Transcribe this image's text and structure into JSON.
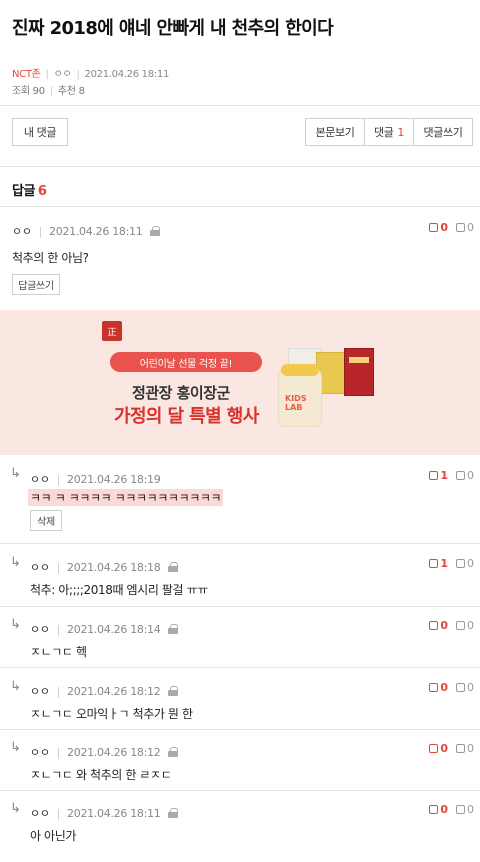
{
  "post": {
    "title": "진짜 2018에 얘네 안빠게 내 천추의 한이다",
    "category": "NCT존",
    "author": "ㅇㅇ",
    "date": "2021.04.26 18:11",
    "views_label": "조회 90",
    "likes_label": "추천 8"
  },
  "buttons": {
    "my_comment": "내 댓글",
    "view_post": "본문보기",
    "comments": "댓글",
    "comments_count": "1",
    "write_comment": "댓글쓰기"
  },
  "replies": {
    "label": "답글",
    "count": "6"
  },
  "comments": [
    {
      "nick": "ㅇㅇ",
      "date": "2021.04.26 18:11",
      "text": "척추의 한 아님?",
      "up": "0",
      "down": "0",
      "action": "답글쓰기"
    },
    {
      "nick": "ㅇㅇ",
      "date": "2021.04.26 18:19",
      "text": "ㅋㅋ ㅋ ㅋㅋㅋㅋ ㅋㅋㅋㅋㅋㅋㅋㅋㅋㅋ",
      "up": "1",
      "down": "0",
      "action": "삭제"
    },
    {
      "nick": "ㅇㅇ",
      "date": "2021.04.26 18:18",
      "text": "척추: 아;;;;2018때 엠시리 팔걸 ㅠㅠ",
      "up": "1",
      "down": "0"
    },
    {
      "nick": "ㅇㅇ",
      "date": "2021.04.26 18:14",
      "text": "ㅈㄴㄱㄷ 헥",
      "up": "0",
      "down": "0"
    },
    {
      "nick": "ㅇㅇ",
      "date": "2021.04.26 18:12",
      "text": "ㅈㄴㄱㄷ 오마익ㅏㄱ 척추가 뭔 한",
      "up": "0",
      "down": "0"
    },
    {
      "nick": "ㅇㅇ",
      "date": "2021.04.26 18:12",
      "text": "ㅈㄴㄱㄷ 와 척추의 한 ㄹㅈㄷ",
      "up": "0",
      "down": "0"
    },
    {
      "nick": "ㅇㅇ",
      "date": "2021.04.26 18:11",
      "text": "아 아닌가",
      "up": "0",
      "down": "0"
    }
  ],
  "ad": {
    "logo": "正",
    "pill": "어린이날 선물 걱정 끝!",
    "headline1": "정관장 홍이장군",
    "headline2": "가정의 달 특별 행사",
    "jar_label": "KIDS LAB"
  },
  "colors": {
    "accent": "#e0463c",
    "highlight": "#fbd9d6",
    "ad_bg": "#fbe7e2"
  }
}
